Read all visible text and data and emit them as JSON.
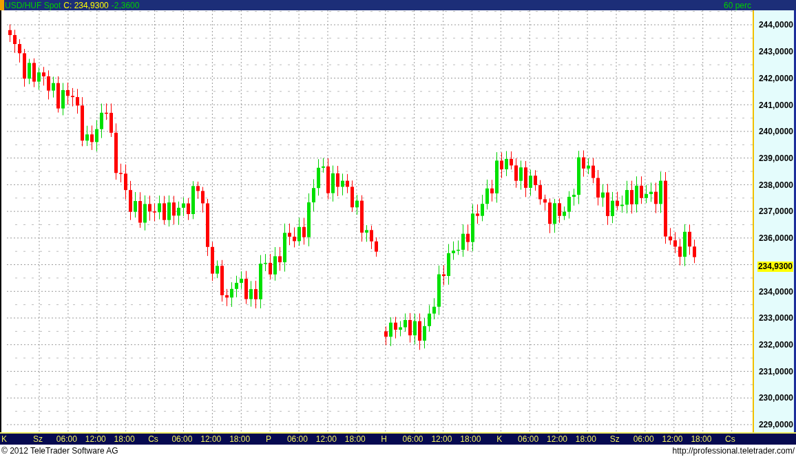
{
  "header": {
    "symbol": "USD/HUF Spot",
    "close": "C: 234,9300",
    "change": "-2,3600",
    "interval": "60 perc"
  },
  "y_axis": {
    "labels": [
      {
        "kind": "tick",
        "text": "244,0000"
      },
      {
        "kind": "tick",
        "text": "243,0000"
      },
      {
        "kind": "tick",
        "text": "242,0000"
      },
      {
        "kind": "tick",
        "text": "241,0000"
      },
      {
        "kind": "tick",
        "text": "240,0000"
      },
      {
        "kind": "tick",
        "text": "239,0000"
      },
      {
        "kind": "tick",
        "text": "238,0000"
      },
      {
        "kind": "tick",
        "text": "237,0000"
      },
      {
        "kind": "tick",
        "text": "236,0000"
      },
      {
        "kind": "last_price",
        "text": "234,9300"
      },
      {
        "kind": "tick",
        "text": "234,0000"
      },
      {
        "kind": "tick",
        "text": "233,0000"
      },
      {
        "kind": "tick",
        "text": "232,0000"
      },
      {
        "kind": "tick",
        "text": "231,0000"
      },
      {
        "kind": "tick",
        "text": "230,0000"
      },
      {
        "kind": "tick",
        "text": "229,0000"
      }
    ]
  },
  "x_axis": {
    "labels": [
      "K",
      "Sz",
      "06:00",
      "12:00",
      "18:00",
      "Cs",
      "06:00",
      "12:00",
      "18:00",
      "P",
      "06:00",
      "12:00",
      "18:00",
      "H",
      "06:00",
      "12:00",
      "18:00",
      "K",
      "06:00",
      "12:00",
      "18:00",
      "Sz",
      "06:00",
      "12:00",
      "18:00",
      "Cs"
    ]
  },
  "footer": {
    "copyright": "© 2012 TeleTrader Software AG",
    "url": "http://professional.teletrader.com/"
  }
}
